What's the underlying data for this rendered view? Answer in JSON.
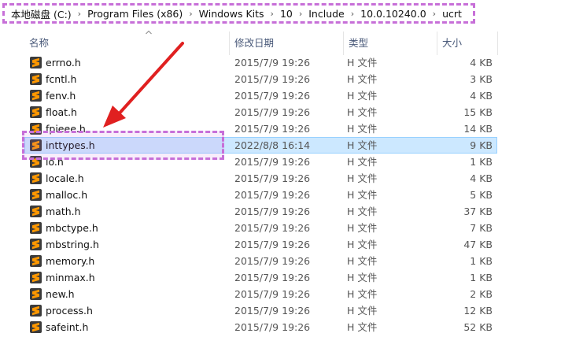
{
  "breadcrumb": [
    "本地磁盘 (C:)",
    "Program Files (x86)",
    "Windows Kits",
    "10",
    "Include",
    "10.0.10240.0",
    "ucrt"
  ],
  "columns": {
    "name": "名称",
    "date": "修改日期",
    "type": "类型",
    "size": "大小"
  },
  "files": [
    {
      "name": "errno.h",
      "date": "2015/7/9 19:26",
      "type": "H 文件",
      "size": "4 KB"
    },
    {
      "name": "fcntl.h",
      "date": "2015/7/9 19:26",
      "type": "H 文件",
      "size": "3 KB"
    },
    {
      "name": "fenv.h",
      "date": "2015/7/9 19:26",
      "type": "H 文件",
      "size": "4 KB"
    },
    {
      "name": "float.h",
      "date": "2015/7/9 19:26",
      "type": "H 文件",
      "size": "15 KB"
    },
    {
      "name": "fpieee.h",
      "date": "2015/7/9 19:26",
      "type": "H 文件",
      "size": "14 KB"
    },
    {
      "name": "inttypes.h",
      "date": "2022/8/8 16:14",
      "type": "H 文件",
      "size": "9 KB",
      "selected": true
    },
    {
      "name": "io.h",
      "date": "2015/7/9 19:26",
      "type": "H 文件",
      "size": "1 KB"
    },
    {
      "name": "locale.h",
      "date": "2015/7/9 19:26",
      "type": "H 文件",
      "size": "4 KB"
    },
    {
      "name": "malloc.h",
      "date": "2015/7/9 19:26",
      "type": "H 文件",
      "size": "5 KB"
    },
    {
      "name": "math.h",
      "date": "2015/7/9 19:26",
      "type": "H 文件",
      "size": "37 KB"
    },
    {
      "name": "mbctype.h",
      "date": "2015/7/9 19:26",
      "type": "H 文件",
      "size": "7 KB"
    },
    {
      "name": "mbstring.h",
      "date": "2015/7/9 19:26",
      "type": "H 文件",
      "size": "47 KB"
    },
    {
      "name": "memory.h",
      "date": "2015/7/9 19:26",
      "type": "H 文件",
      "size": "1 KB"
    },
    {
      "name": "minmax.h",
      "date": "2015/7/9 19:26",
      "type": "H 文件",
      "size": "1 KB"
    },
    {
      "name": "new.h",
      "date": "2015/7/9 19:26",
      "type": "H 文件",
      "size": "2 KB"
    },
    {
      "name": "process.h",
      "date": "2015/7/9 19:26",
      "type": "H 文件",
      "size": "12 KB"
    },
    {
      "name": "safeint.h",
      "date": "2015/7/9 19:26",
      "type": "H 文件",
      "size": "52 KB"
    }
  ],
  "colors": {
    "selection": "#cce8ff",
    "annotation": "#c76fd8",
    "arrow": "#e02020",
    "file_icon": "#ff9800"
  },
  "icons": {
    "file": "sublime-text-icon",
    "separator": "chevron-right-icon",
    "sort": "sort-ascending-icon"
  }
}
